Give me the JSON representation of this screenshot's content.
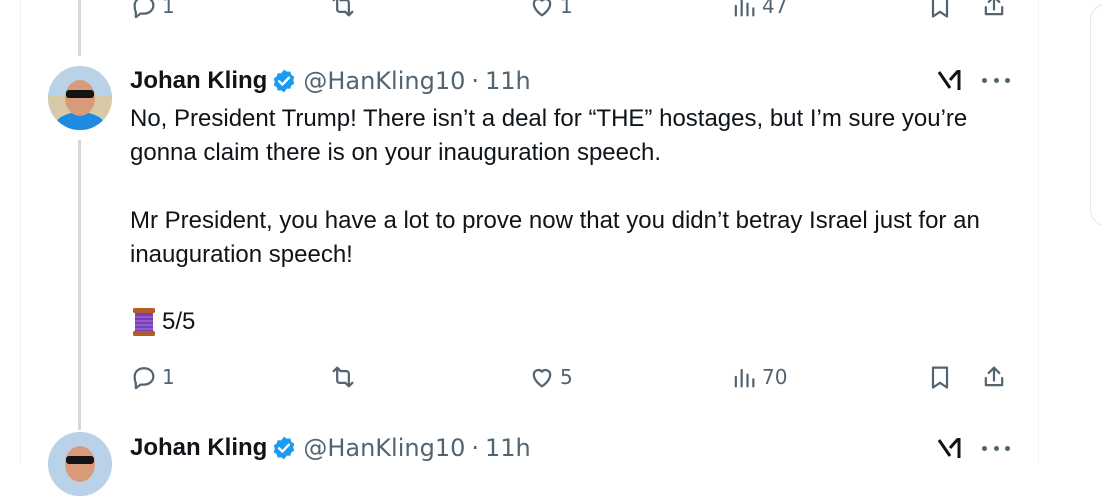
{
  "prev_tweet": {
    "actions": {
      "replies": "1",
      "reposts": "",
      "likes": "1",
      "views": "47"
    }
  },
  "tweet": {
    "author_name": "Johan Kling",
    "handle": "@HanKling10",
    "separator": "·",
    "time": "11h",
    "paragraphs": [
      "No, President Trump! There isn’t a deal for “THE” hostages, but I’m sure you’re gonna claim there is on your inauguration speech.",
      "Mr President, you have a lot to prove now that you didn’t betray Israel just for an inauguration speech!"
    ],
    "thread_count": "5/5",
    "actions": {
      "replies": "1",
      "reposts": "",
      "likes": "5",
      "views": "70"
    }
  },
  "next_tweet": {
    "author_name": "Johan Kling",
    "handle": "@HanKling10",
    "separator": "·",
    "time": "11h"
  },
  "colors": {
    "verified": "#1d9bf0",
    "secondary_text": "#536471",
    "thread_line": "#cfd9de"
  },
  "icons": [
    "reply-icon",
    "repost-icon",
    "like-icon",
    "views-icon",
    "bookmark-icon",
    "share-icon",
    "verified-badge-icon",
    "grok-icon",
    "more-icon",
    "thread-spool-icon"
  ]
}
